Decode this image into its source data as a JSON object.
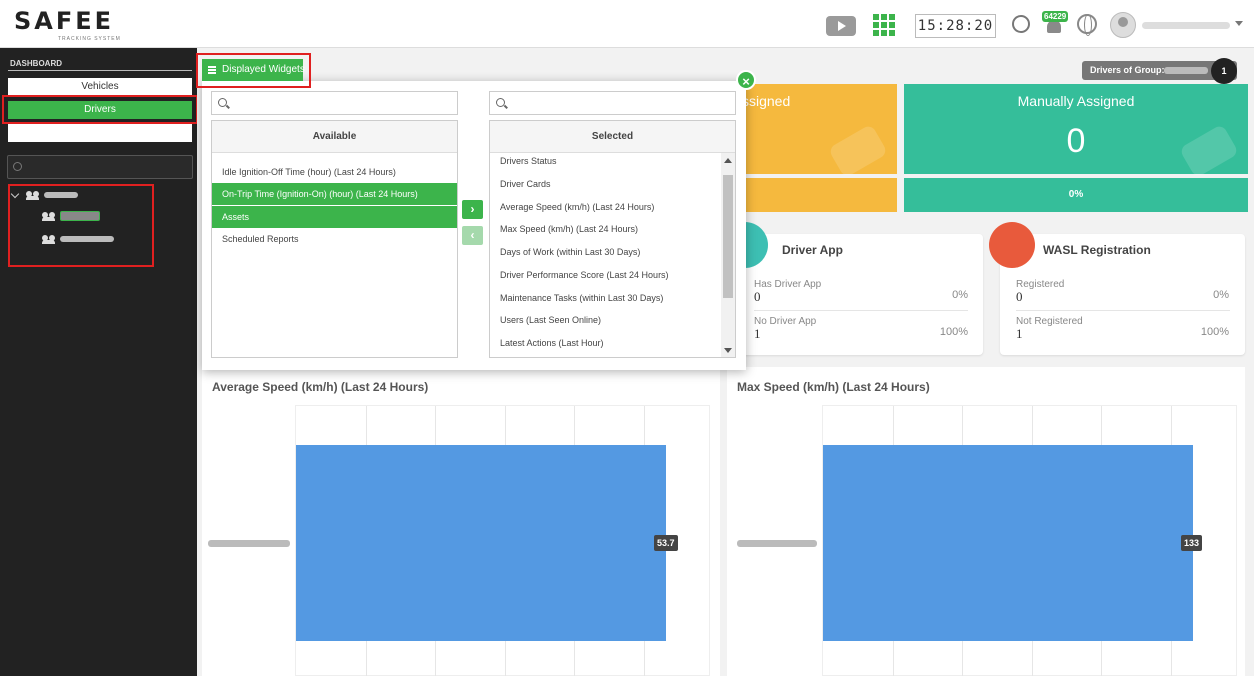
{
  "header": {
    "logo_text": "SAFEE",
    "logo_subtext": "TRACKING SYSTEM",
    "clock": "15:28:20",
    "notification_count": "64229",
    "icons": [
      "play-video-icon",
      "apps-grid-icon",
      "phone-icon",
      "bell-icon",
      "globe-icon",
      "user-avatar-icon",
      "chevron-down-icon"
    ]
  },
  "sidebar": {
    "title": "DASHBOARD",
    "tabs": [
      {
        "label": "Vehicles",
        "active": false
      },
      {
        "label": "Drivers",
        "active": true
      },
      {
        "label": "",
        "active": false
      }
    ],
    "search_placeholder": ""
  },
  "toolbar": {
    "widgets_button": "Displayed Widgets",
    "group_label": "Drivers of Group:",
    "group_count": "1"
  },
  "stats": {
    "yellow_label": "ssigned",
    "green_label": "Manually Assigned",
    "green_value": "0",
    "green_percent": "0%"
  },
  "cards": [
    {
      "title": "Driver App",
      "icon": "tablet-icon",
      "color": "#3dbfb3",
      "rows": [
        {
          "label": "Has Driver App",
          "value": "0",
          "percent": "0%"
        },
        {
          "label": "No Driver App",
          "value": "1",
          "percent": "100%"
        }
      ]
    },
    {
      "title": "WASL Registration",
      "icon": "id-card-icon",
      "color": "#e85a3c",
      "rows": [
        {
          "label": "Registered",
          "value": "0",
          "percent": "0%"
        },
        {
          "label": "Not Registered",
          "value": "1",
          "percent": "100%"
        }
      ]
    }
  ],
  "chart_data": [
    {
      "type": "bar",
      "title": "Average Speed (km/h) (Last 24 Hours)",
      "orientation": "horizontal",
      "categories": [
        ""
      ],
      "values": [
        53.7
      ],
      "value_labels": [
        "53.7"
      ]
    },
    {
      "type": "bar",
      "title": "Max Speed (km/h) (Last 24 Hours)",
      "orientation": "horizontal",
      "categories": [
        ""
      ],
      "values": [
        133
      ],
      "value_labels": [
        "133"
      ]
    }
  ],
  "modal": {
    "available_header": "Available",
    "selected_header": "Selected",
    "available_search_placeholder": "",
    "selected_search_placeholder": "",
    "available_items": [
      {
        "label": "Idle Ignition-Off Time (hour) (Last 24 Hours)",
        "highlighted": false
      },
      {
        "label": "On-Trip Time (Ignition-On) (hour) (Last 24 Hours)",
        "highlighted": true
      },
      {
        "label": "Assets",
        "highlighted": true
      },
      {
        "label": "Scheduled Reports",
        "highlighted": false
      }
    ],
    "selected_items": [
      "Drivers Status",
      "Driver Cards",
      "Average Speed (km/h) (Last 24 Hours)",
      "Max Speed (km/h) (Last 24 Hours)",
      "Days of Work (within Last 30 Days)",
      "Driver Performance Score (Last 24 Hours)",
      "Maintenance Tasks (within Last 30 Days)",
      "Users (Last Seen Online)",
      "Latest Actions (Last Hour)"
    ],
    "move_right_symbol": "›",
    "move_left_symbol": "‹",
    "close_symbol": "×"
  },
  "colors": {
    "brand_green": "#3cb44b",
    "stat_yellow": "#f5b93e",
    "stat_teal": "#35be9a",
    "bar_blue": "#5499e2",
    "annotation_red": "#e02020"
  }
}
